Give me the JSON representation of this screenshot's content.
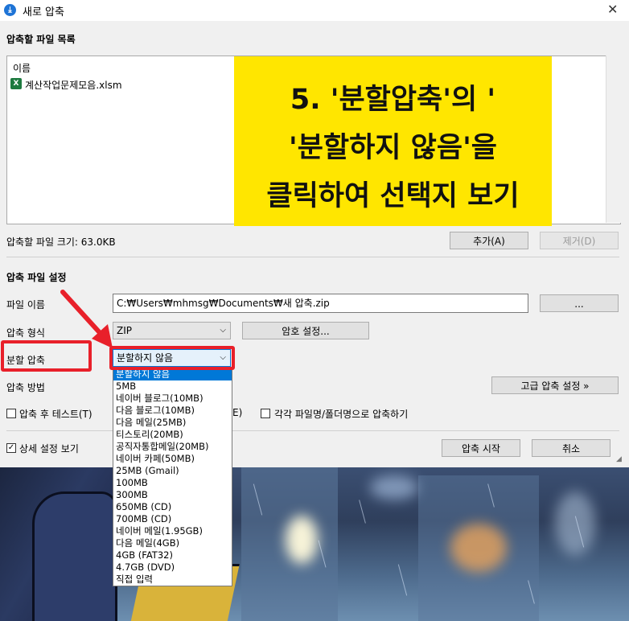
{
  "window": {
    "title": "새로 압축",
    "close_glyph": "✕",
    "icon_glyph": "⤓"
  },
  "file_list": {
    "section_title": "압축할 파일 목록",
    "column_header": "이름",
    "files": [
      {
        "name": "계산작업문제모음.xlsm",
        "icon": "excel-icon"
      }
    ],
    "size_label": "압축할 파일 크기: 63.0KB",
    "add_button": "추가(A)",
    "remove_button": "제거(D)"
  },
  "settings": {
    "section_title": "압축 파일 설정",
    "filename_label": "파일 이름",
    "filename_value": "C:₩Users₩mhmsg₩Documents₩새 압축.zip",
    "browse_button": "...",
    "format_label": "압축 형식",
    "format_value": "ZIP",
    "password_button": "암호 설정...",
    "split_label": "분할 압축",
    "split_value": "분할하지 않음",
    "method_label": "압축 방법",
    "advanced_button": "고급 압축 설정 »",
    "test_after_label": "압축 후 테스트(T)",
    "test_after_checked": false,
    "partial_e_label": "E)",
    "each_file_label": "각각 파일명/폴더명으로 압축하기",
    "each_file_checked": false,
    "details_label": "상세 설정 보기",
    "details_checked": true,
    "start_button": "압축 시작",
    "cancel_button": "취소"
  },
  "split_dropdown": {
    "options": [
      "분할하지 않음",
      "5MB",
      "네이버 블로그(10MB)",
      "다음 블로그(10MB)",
      "다음 메일(25MB)",
      "티스토리(20MB)",
      "공직자통합메일(20MB)",
      "네이버 카페(50MB)",
      "25MB (Gmail)",
      "100MB",
      "300MB",
      "650MB (CD)",
      "700MB (CD)",
      "네이버 메일(1.95GB)",
      "다음 메일(4GB)",
      "4GB (FAT32)",
      "4.7GB (DVD)",
      "직접 입력"
    ],
    "selected_index": 0
  },
  "annotation": {
    "lines": [
      "5. '분할압축'의 '",
      "'분할하지 않음'을",
      "클릭하여 선택지 보기"
    ],
    "color": "#ffe600",
    "highlight_color": "#e8202a"
  },
  "checkmark_glyph": "✓",
  "chevron_glyph": "⌵"
}
